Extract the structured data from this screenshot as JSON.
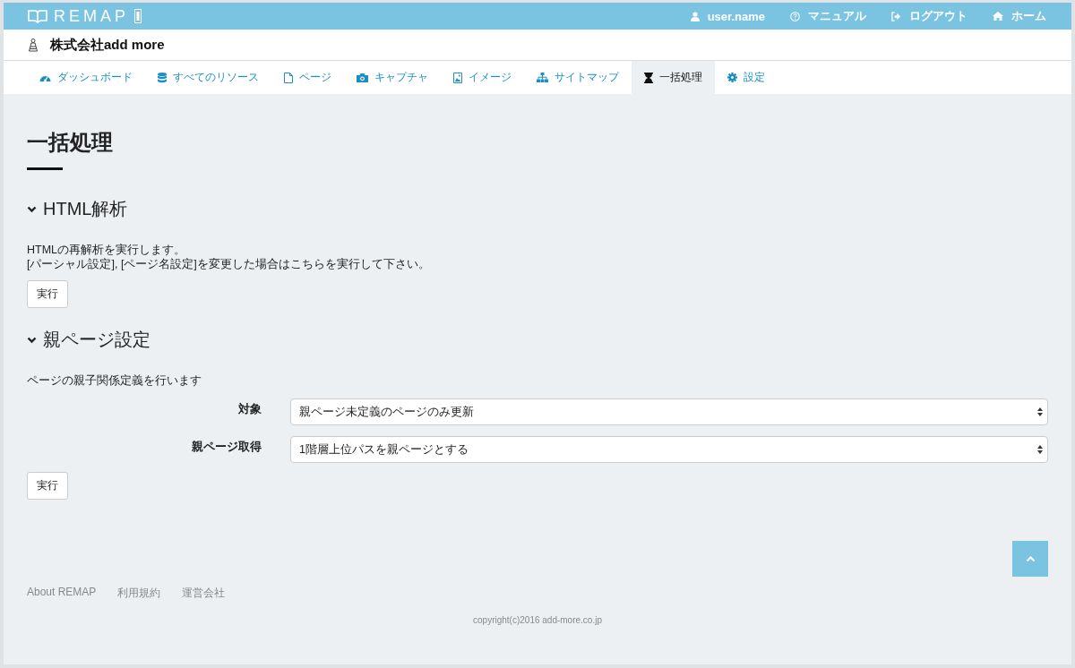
{
  "header": {
    "logo": "REMAP",
    "user": "user.name",
    "links": [
      {
        "label": "マニュアル"
      },
      {
        "label": "ログアウト"
      },
      {
        "label": "ホーム"
      }
    ]
  },
  "company": "株式会社add more",
  "tabs": [
    {
      "label": "ダッシュボード",
      "selected": false
    },
    {
      "label": "すべてのリソース",
      "selected": false
    },
    {
      "label": "ページ",
      "selected": false
    },
    {
      "label": "キャプチャ",
      "selected": false
    },
    {
      "label": "イメージ",
      "selected": false
    },
    {
      "label": "サイトマップ",
      "selected": false
    },
    {
      "label": "一括処理",
      "selected": true
    },
    {
      "label": "設定",
      "selected": false
    }
  ],
  "page_title": "一括処理",
  "sections": [
    {
      "title": "HTML解析",
      "expanded": true,
      "lines": [
        "HTMLの再解析を実行します。",
        "[パーシャル設定], [ページ名設定]を変更した場合はこちらを実行して下さい。"
      ],
      "button": "実行"
    },
    {
      "title": "親ページ設定",
      "expanded": true,
      "lines": [
        "ページの親子関係定義を行います"
      ],
      "fields": [
        {
          "label": "対象",
          "value": "親ページ未定義のページのみ更新"
        },
        {
          "label": "親ページ取得",
          "value": "1階層上位パスを親ページとする"
        }
      ],
      "button": "実行"
    }
  ],
  "footer": {
    "links": [
      "About REMAP",
      "利用規約",
      "運営会社"
    ],
    "copyright": "copyright(c)2016 add-more.co.jp"
  }
}
